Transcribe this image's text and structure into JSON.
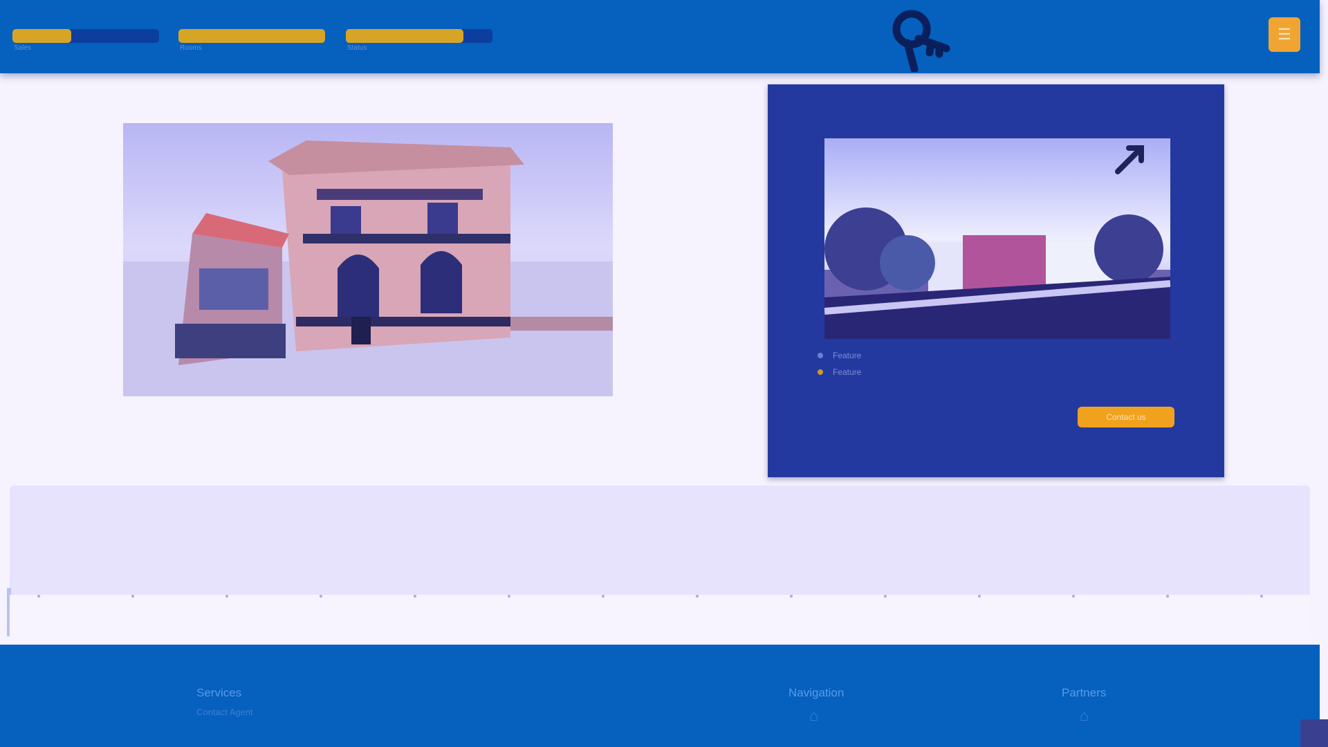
{
  "topbar": {
    "bars": [
      {
        "label": "Sales",
        "fill": 0.4
      },
      {
        "label": "Rooms",
        "fill": 1.0
      },
      {
        "label": "Status",
        "fill": 0.8
      }
    ],
    "logo_icon": "key-icon",
    "menu_icon": "menu-icon"
  },
  "hero": {
    "left_image_icon": "house-rendering",
    "card": {
      "image_icon": "house-street-photo",
      "expand_icon": "expand-icon",
      "features": [
        "Feature",
        "Feature"
      ],
      "cta_label": "Contact us"
    }
  },
  "footer": {
    "col1": {
      "heading": "Services",
      "sub": "Contact Agent"
    },
    "col2": {
      "heading": "Navigation",
      "icon": "home-icon"
    },
    "col3": {
      "heading": "Partners",
      "icon": "home-icon"
    }
  },
  "colors": {
    "primary": "#0560be",
    "card": "#2439a0",
    "accent": "#f0a21f",
    "background": "#f6f2fe"
  }
}
